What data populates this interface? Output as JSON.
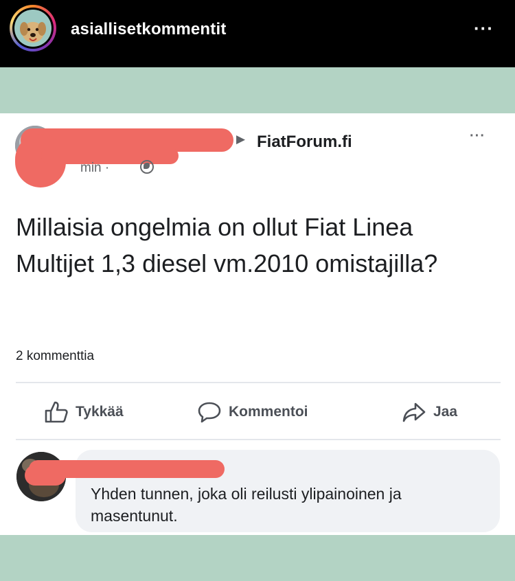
{
  "instagram": {
    "username": "asiallisetkommentit",
    "more_icon": "···"
  },
  "post": {
    "group_name": "FiatForum.fi",
    "time": "min ·",
    "more_icon": "···",
    "text": "Millaisia ongelmia on ollut Fiat Linea Multijet 1,3 diesel vm.2010 omistajilla?",
    "comment_count": "2 kommenttia",
    "actions": {
      "like": "Tykkää",
      "comment": "Kommentoi",
      "share": "Jaa"
    }
  },
  "comment": {
    "text": "Yhden tunnen, joka oli reilusti ylipainoinen ja masentunut."
  },
  "colors": {
    "background": "#b3d3c4",
    "redaction": "#ef6a63",
    "header": "#000000"
  },
  "icons": [
    "more-horizontal-icon",
    "globe-icon",
    "like-icon",
    "comment-icon",
    "share-icon"
  ]
}
